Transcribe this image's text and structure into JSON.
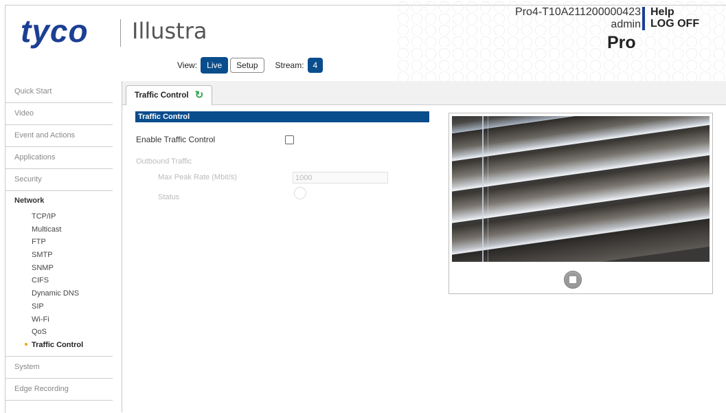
{
  "header": {
    "brand": "tyco",
    "product": "Illustra",
    "device_id": "Pro4-T10A211200000423",
    "user": "admin",
    "help": "Help",
    "logoff": "LOG OFF",
    "model": "Pro"
  },
  "viewbar": {
    "view_label": "View:",
    "live": "Live",
    "setup": "Setup",
    "stream_label": "Stream:",
    "stream_value": "4"
  },
  "sidebar": {
    "top_items": [
      "Quick Start",
      "Video",
      "Event and Actions",
      "Applications",
      "Security"
    ],
    "network": {
      "label": "Network",
      "items": [
        "TCP/IP",
        "Multicast",
        "FTP",
        "SMTP",
        "SNMP",
        "CIFS",
        "Dynamic DNS",
        "SIP",
        "Wi-Fi",
        "QoS",
        "Traffic Control"
      ]
    },
    "bottom_items": [
      "System",
      "Edge Recording"
    ]
  },
  "tab": {
    "label": "Traffic Control"
  },
  "form": {
    "section_title": "Traffic Control",
    "enable_label": "Enable Traffic Control",
    "enable_checked": false,
    "outbound_label": "Outbound Traffic",
    "max_peak_label": "Max Peak Rate (Mbit/s)",
    "max_peak_value": "1000",
    "status_label": "Status"
  },
  "colors": {
    "brand_blue": "#1c3f94",
    "accent_blue": "#0a4d8c",
    "selected_dot": "#f0a800",
    "refresh_green": "#2fa24a"
  }
}
